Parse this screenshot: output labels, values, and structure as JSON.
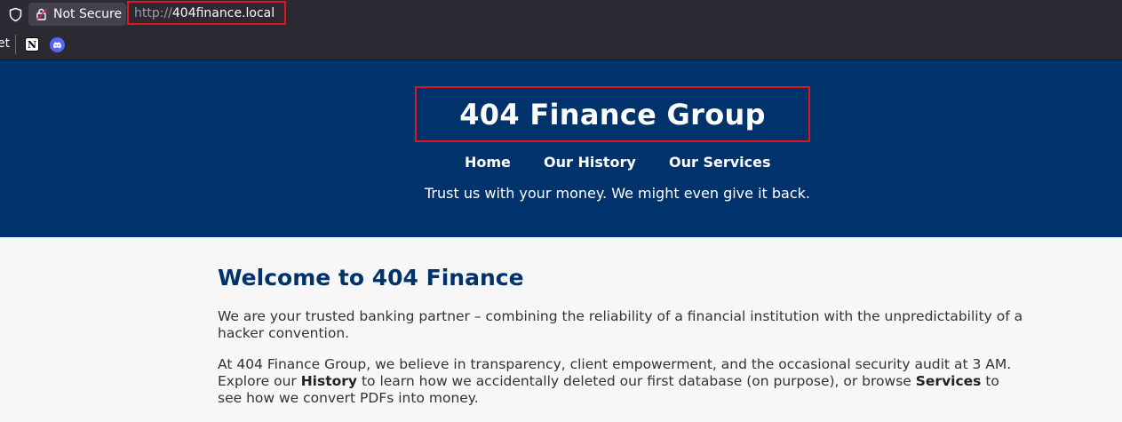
{
  "browser": {
    "security_label": "Not Secure",
    "url_scheme": "http://",
    "url_host": "404finance.local",
    "bookmarks": {
      "cut_label": "et",
      "items": [
        "notion-icon",
        "discord-icon"
      ]
    }
  },
  "site": {
    "brand": "404 Finance Group",
    "nav": {
      "home": "Home",
      "history": "Our History",
      "services": "Our Services"
    },
    "tagline": "Trust us with your money. We might even give it back."
  },
  "main": {
    "heading": "Welcome to 404 Finance",
    "p1": "We are your trusted banking partner – combining the reliability of a financial institution with the unpredictability of a hacker convention.",
    "p2": {
      "a": "At 404 Finance Group, we believe in transparency, client empowerment, and the occasional security audit at 3 AM. Explore our ",
      "b": "History",
      "c": " to learn how we accidentally deleted our first database (on purpose), or browse ",
      "d": "Services",
      "e": " to see how we convert PDFs into money."
    }
  },
  "colors": {
    "header_bg": "#00326c",
    "heading": "#00326c",
    "highlight": "#e0141e",
    "chrome_bg": "#2b2a33"
  }
}
